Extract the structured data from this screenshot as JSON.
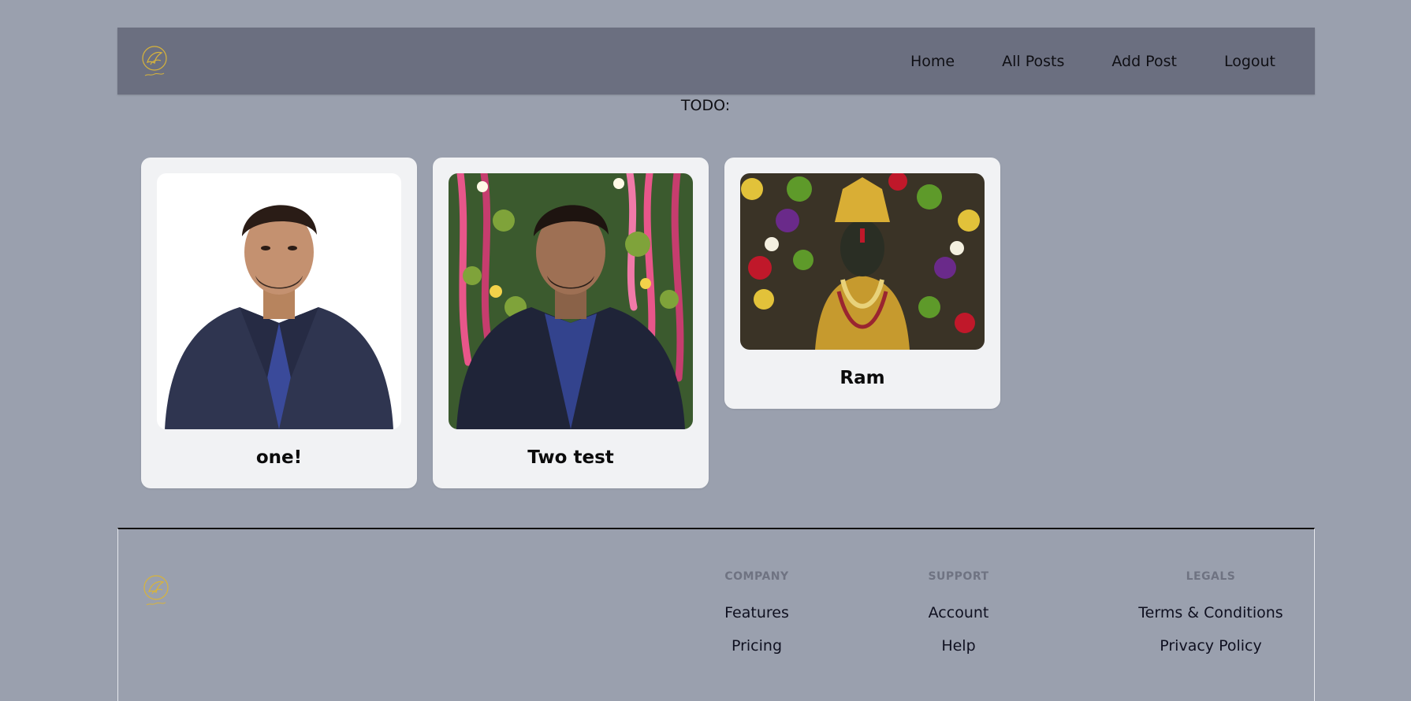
{
  "header": {
    "nav": [
      {
        "label": "Home"
      },
      {
        "label": "All Posts"
      },
      {
        "label": "Add Post"
      },
      {
        "label": "Logout"
      }
    ]
  },
  "main": {
    "todo_text": "TODO:",
    "posts": [
      {
        "title": "one!"
      },
      {
        "title": "Two test"
      },
      {
        "title": "Ram"
      }
    ]
  },
  "footer": {
    "columns": [
      {
        "heading": "COMPANY",
        "links": [
          "Features",
          "Pricing"
        ]
      },
      {
        "heading": "SUPPORT",
        "links": [
          "Account",
          "Help"
        ]
      },
      {
        "heading": "LEGALS",
        "links": [
          "Terms & Conditions",
          "Privacy Policy"
        ]
      }
    ]
  },
  "colors": {
    "page_bg": "#9aa0ae",
    "header_bg": "#6b6f80",
    "card_bg": "#f1f2f4",
    "logo_gold": "#d8b43a"
  },
  "icons": {
    "logo": "dove-logo-icon"
  }
}
